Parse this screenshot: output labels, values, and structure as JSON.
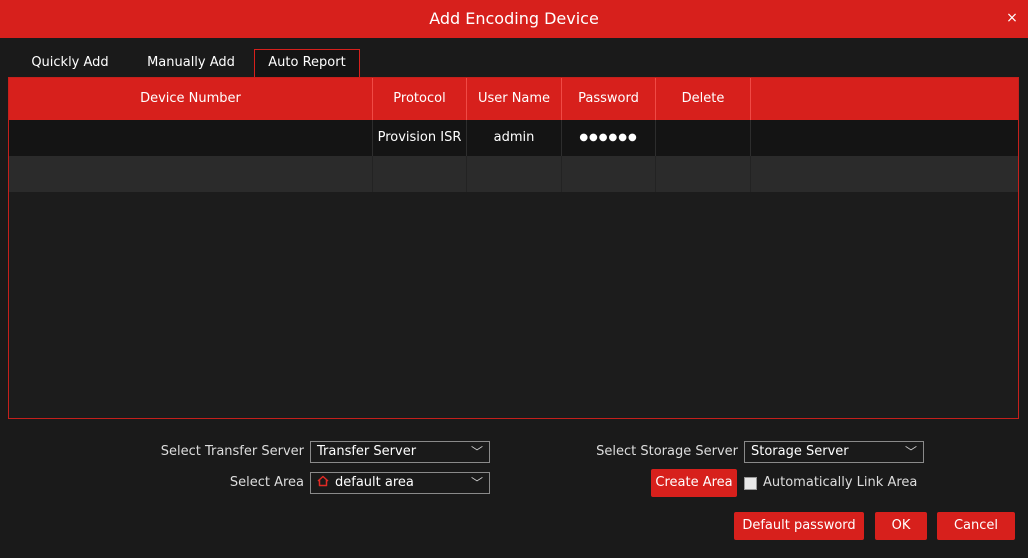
{
  "dialog": {
    "title": "Add Encoding Device",
    "close_glyph": "×"
  },
  "tabs": [
    {
      "label": "Quickly Add",
      "active": false
    },
    {
      "label": "Manually Add",
      "active": false
    },
    {
      "label": "Auto Report",
      "active": true
    }
  ],
  "table": {
    "columns": [
      "Device Number",
      "Protocol",
      "User Name",
      "Password",
      "Delete"
    ],
    "rows": [
      {
        "device_number": "",
        "protocol": "Provision ISR",
        "user_name": "admin",
        "password": "●●●●●●",
        "delete": ""
      }
    ]
  },
  "form": {
    "transfer_server_label": "Select Transfer Server",
    "transfer_server_value": "Transfer Server",
    "storage_server_label": "Select Storage Server",
    "storage_server_value": "Storage Server",
    "area_label": "Select Area",
    "area_value": "default area",
    "create_area_label": "Create Area",
    "auto_link_label": "Automatically Link Area",
    "auto_link_checked": false,
    "chevron_glyph": "﹀"
  },
  "footer": {
    "default_password_label": "Default password",
    "ok_label": "OK",
    "cancel_label": "Cancel"
  },
  "colors": {
    "accent": "#d7201c",
    "background": "#1a1a1a"
  },
  "icons": {
    "close": "close-icon",
    "area": "home-icon",
    "dropdown": "chevron-down-icon"
  }
}
